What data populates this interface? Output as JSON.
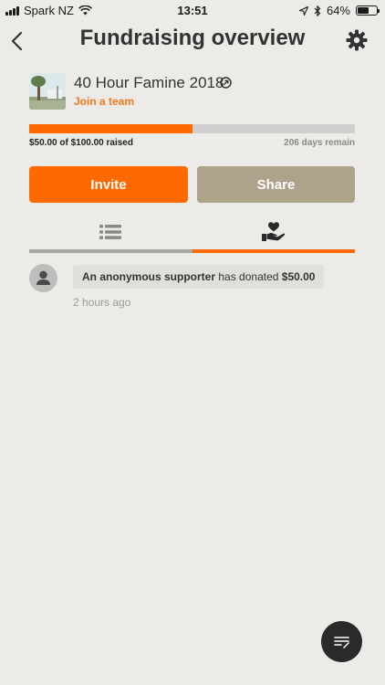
{
  "status_bar": {
    "carrier": "Spark NZ",
    "time": "13:51",
    "battery_pct": "64%",
    "battery_level": 0.64
  },
  "nav": {
    "title": "Fundraising overview",
    "back_icon": "chevron-left-icon",
    "settings_icon": "gear-icon"
  },
  "campaign": {
    "name": "40 Hour Famine 2018",
    "join_label": "Join a team",
    "external_icon": "external-link-icon"
  },
  "progress": {
    "raised_text": "$50.00 of $100.00 raised",
    "remaining_text": "206 days remain",
    "fraction": 0.5
  },
  "actions": {
    "invite_label": "Invite",
    "share_label": "Share"
  },
  "tabs": [
    {
      "icon": "list-icon",
      "active": false
    },
    {
      "icon": "donation-hand-heart-icon",
      "active": true
    }
  ],
  "feed": [
    {
      "supporter": "An anonymous supporter",
      "action": "has donated",
      "amount": "$50.00",
      "time": "2 hours ago"
    }
  ],
  "fab": {
    "icon": "notes-icon"
  },
  "colors": {
    "accent": "#ff6a00",
    "share": "#ada28a",
    "background": "#ecebe7"
  }
}
